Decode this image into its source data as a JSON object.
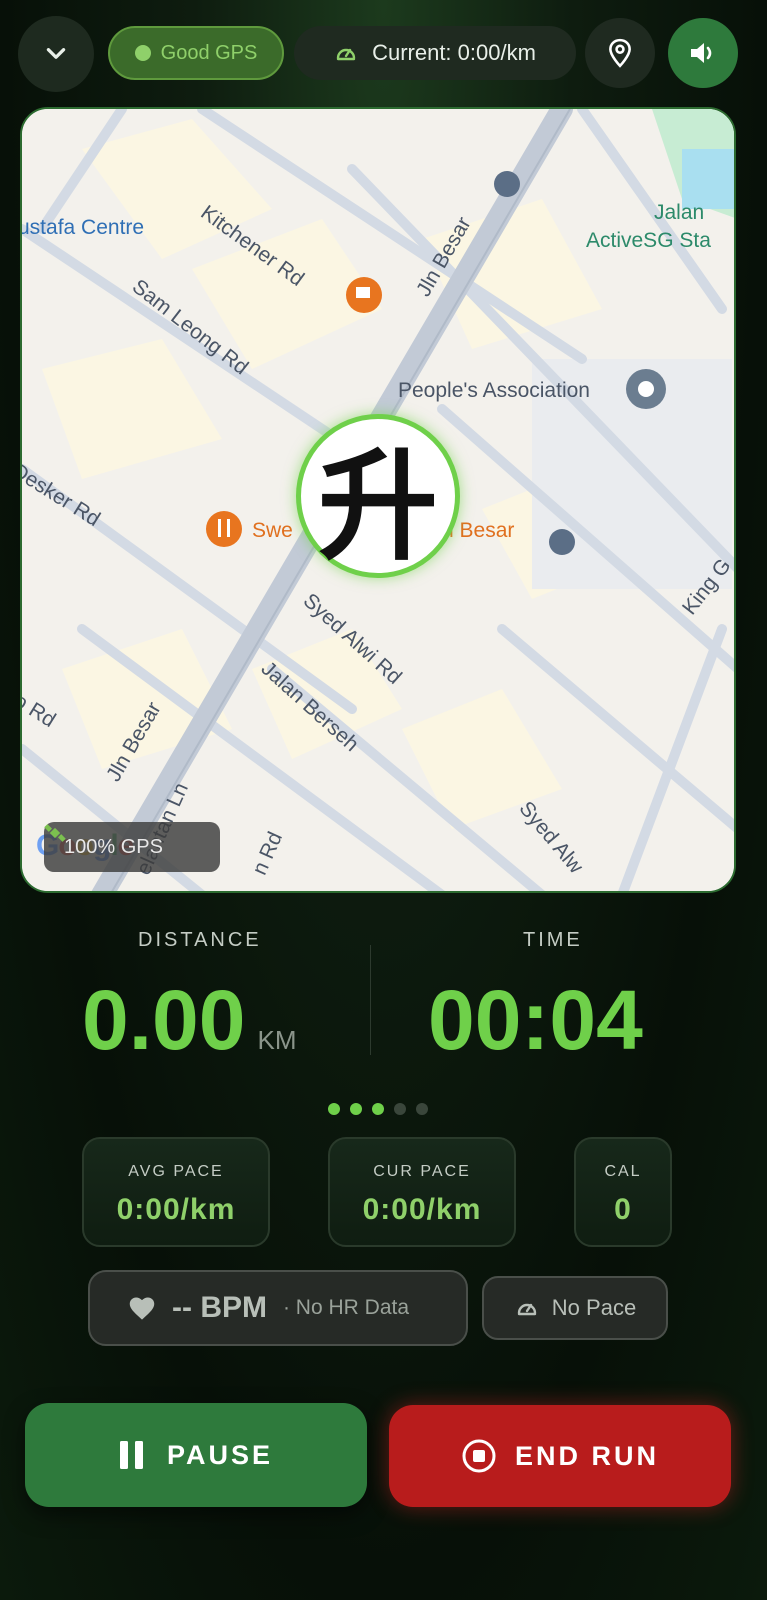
{
  "topbar": {
    "gps_status": "Good GPS",
    "current_pace": "Current: 0:00/km"
  },
  "map": {
    "labels": {
      "mustafa": "ustafa Centre",
      "kitchener": "Kitchener Rd",
      "sam_leong": "Sam Leong Rd",
      "jln_besar_top": "Jln Besar",
      "jln_besar_bottom": "Jln Besar",
      "peoples": "People's Association",
      "jalan_activesg_1": "Jalan",
      "jalan_activesg_2": "ActiveSG Sta",
      "desker": "Desker Rd",
      "swee": "Swe",
      "n_besar": "n Besar",
      "syed_alwi": "Syed Alwi Rd",
      "jalan_berseh": "Jalan Berseh",
      "syed_alw2": "Syed Alw",
      "king": "King G",
      "o_rd": "o Rd",
      "kelantan": "elantan Ln",
      "n_rd": "n Rd"
    },
    "marker_glyph": "升",
    "gps_chip": "100% GPS",
    "google": "Google"
  },
  "stats": {
    "distance_label": "DISTANCE",
    "distance_value": "0.00",
    "distance_unit": "KM",
    "time_label": "TIME",
    "time_value": "00:04"
  },
  "page_dots": {
    "active": 3,
    "total": 5
  },
  "cards": [
    {
      "title": "AVG PACE",
      "value": "0:00/km"
    },
    {
      "title": "CUR PACE",
      "value": "0:00/km"
    },
    {
      "title": "CAL",
      "value": "0"
    }
  ],
  "heart": {
    "bpm": "-- BPM",
    "sub": "· No HR Data"
  },
  "pace_badge": "No Pace",
  "actions": {
    "pause": "PAUSE",
    "end_run": "END RUN"
  },
  "colors": {
    "accent_green": "#6fd04a",
    "pause_green": "#2e7a3c",
    "end_red": "#b81c1c"
  }
}
